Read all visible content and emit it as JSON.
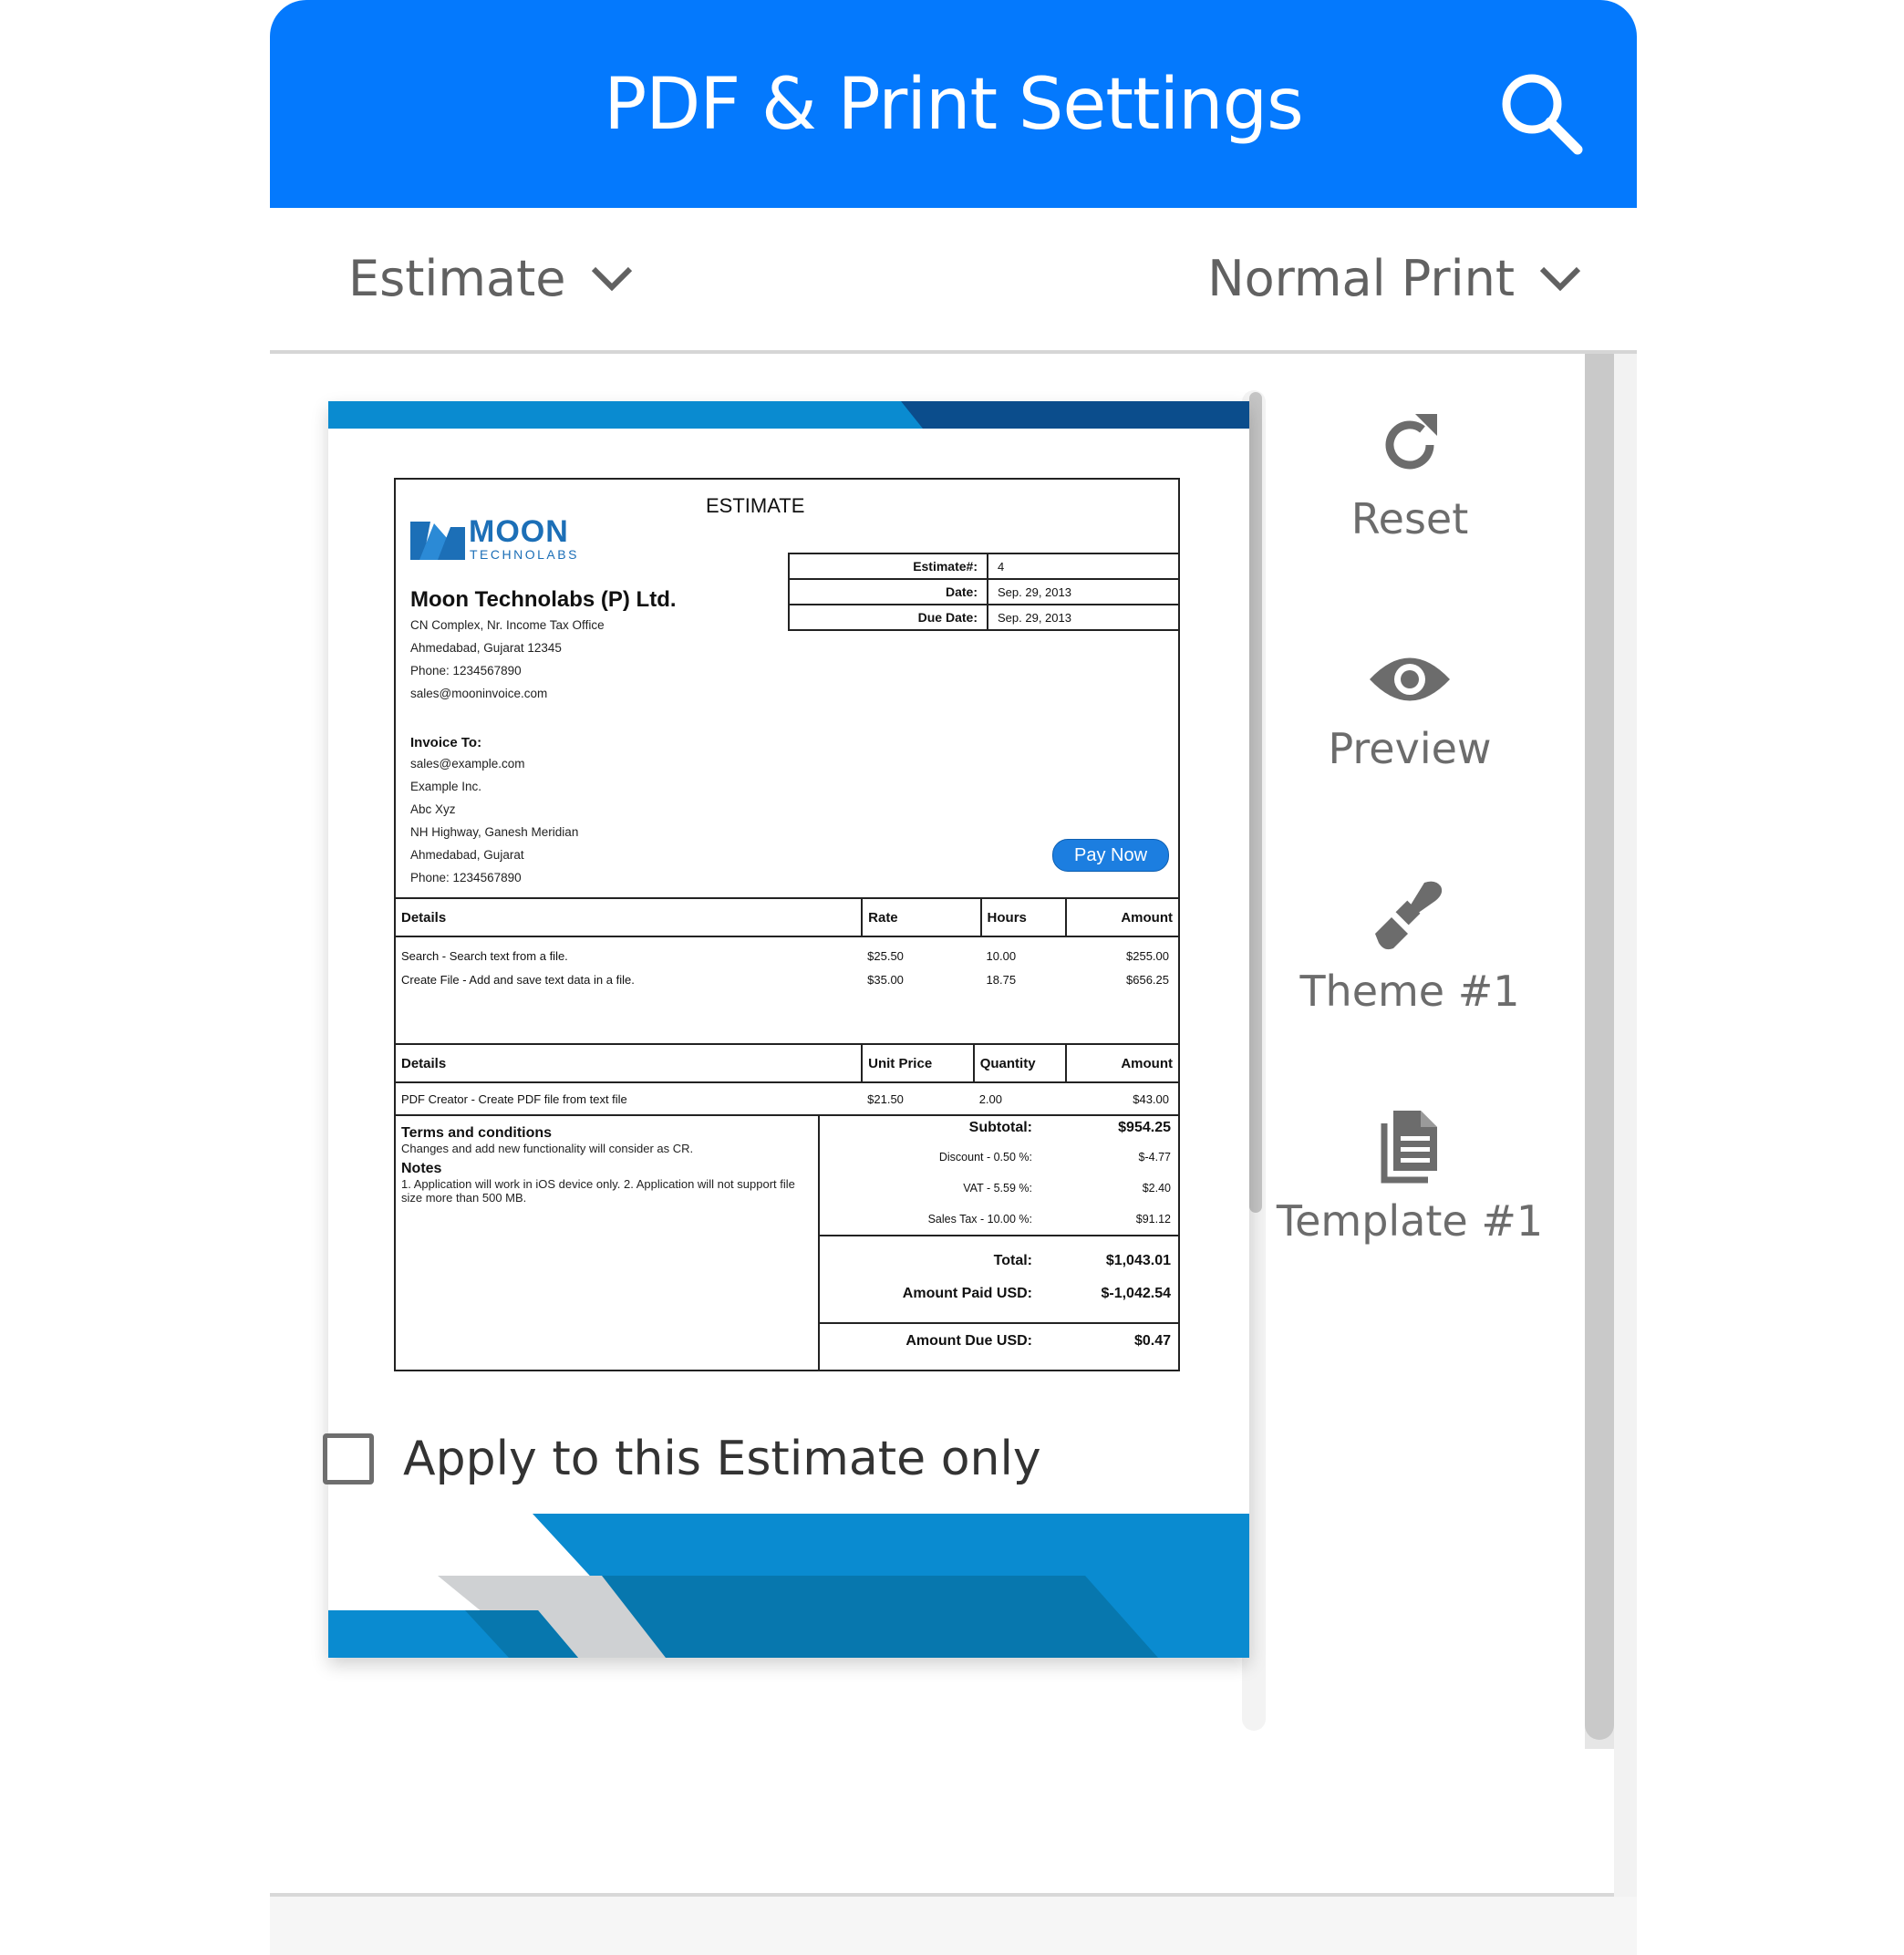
{
  "header": {
    "title": "PDF & Print Settings",
    "search_icon": "search-icon",
    "color": "#0479fd"
  },
  "selectors": {
    "doc_type": "Estimate",
    "print_mode": "Normal Print"
  },
  "document": {
    "title": "ESTIMATE",
    "logo": {
      "name": "MOON",
      "sub": "TECHNOLABS"
    },
    "company": {
      "name": "Moon Technolabs (P) Ltd.",
      "lines": [
        "CN Complex,    Nr. Income Tax Office",
        "Ahmedabad,  Gujarat  12345",
        "Phone: 1234567890",
        "sales@mooninvoice.com"
      ]
    },
    "invoice_to": {
      "label": "Invoice To:",
      "lines": [
        "sales@example.com",
        "Example Inc.",
        "Abc Xyz",
        "NH Highway,    Ganesh Meridian",
        "Ahmedabad,  Gujarat",
        "Phone: 1234567890"
      ]
    },
    "meta": [
      {
        "label": "Estimate#:",
        "value": "4"
      },
      {
        "label": "Date:",
        "value": "Sep. 29, 2013"
      },
      {
        "label": "Due Date:",
        "value": "Sep. 29, 2013"
      }
    ],
    "pay_now": "Pay Now",
    "services": {
      "headers": [
        "Details",
        "Rate",
        "Hours",
        "Amount"
      ],
      "rows": [
        [
          "Search - Search text from a file.",
          "$25.50",
          "10.00",
          "$255.00"
        ],
        [
          "Create File - Add and save text data in a file.",
          "$35.00",
          "18.75",
          "$656.25"
        ]
      ]
    },
    "products": {
      "headers": [
        "Details",
        "Unit Price",
        "Quantity",
        "Amount"
      ],
      "rows": [
        [
          "PDF Creator - Create PDF file from text file",
          "$21.50",
          "2.00",
          "$43.00"
        ]
      ]
    },
    "terms": {
      "title": "Terms and conditions",
      "text": "Changes and add new functionality will consider as CR.",
      "notes_title": "Notes",
      "notes_text": "1. Application will work in iOS device only. 2. Application will not support file size more than 500 MB."
    },
    "totals": {
      "subtotal": {
        "label": "Subtotal:",
        "value": "$954.25"
      },
      "discount": {
        "label": "Discount - 0.50 %:",
        "value": "$-4.77"
      },
      "vat": {
        "label": "VAT - 5.59 %:",
        "value": "$2.40"
      },
      "sales_tax": {
        "label": "Sales Tax - 10.00 %:",
        "value": "$91.12"
      },
      "total": {
        "label": "Total:",
        "value": "$1,043.01"
      },
      "paid": {
        "label": "Amount Paid USD:",
        "value": "$-1,042.54"
      },
      "due": {
        "label": "Amount Due USD:",
        "value": "$0.47"
      }
    }
  },
  "actions": [
    {
      "label": "Reset",
      "icon": "refresh-icon"
    },
    {
      "label": "Preview",
      "icon": "eye-icon"
    },
    {
      "label": "Theme #1",
      "icon": "paintbrush-icon"
    },
    {
      "label": "Template #1",
      "icon": "document-icon"
    }
  ],
  "apply_option": {
    "label": "Apply to this Estimate only",
    "checked": false
  }
}
